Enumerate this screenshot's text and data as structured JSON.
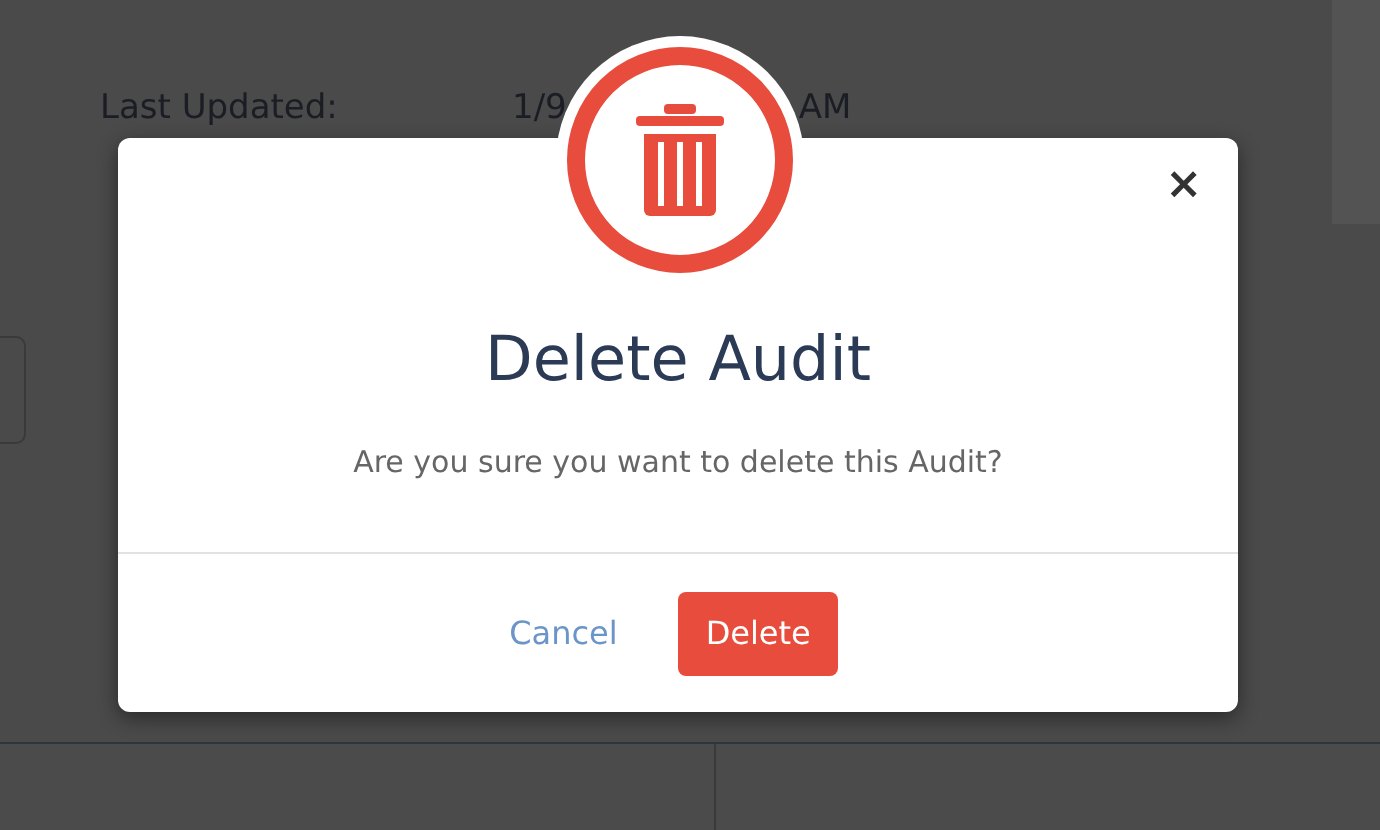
{
  "details": [
    {
      "label": "Last Updated:",
      "value_parts": [
        "1/9",
        "AM"
      ]
    }
  ],
  "dialog": {
    "title": "Delete Audit",
    "message": "Are you sure you want to delete this Audit?",
    "close": "×",
    "buttons": [
      {
        "label": "Cancel",
        "kind": "link"
      },
      {
        "label": "Delete",
        "kind": "danger"
      }
    ]
  }
}
